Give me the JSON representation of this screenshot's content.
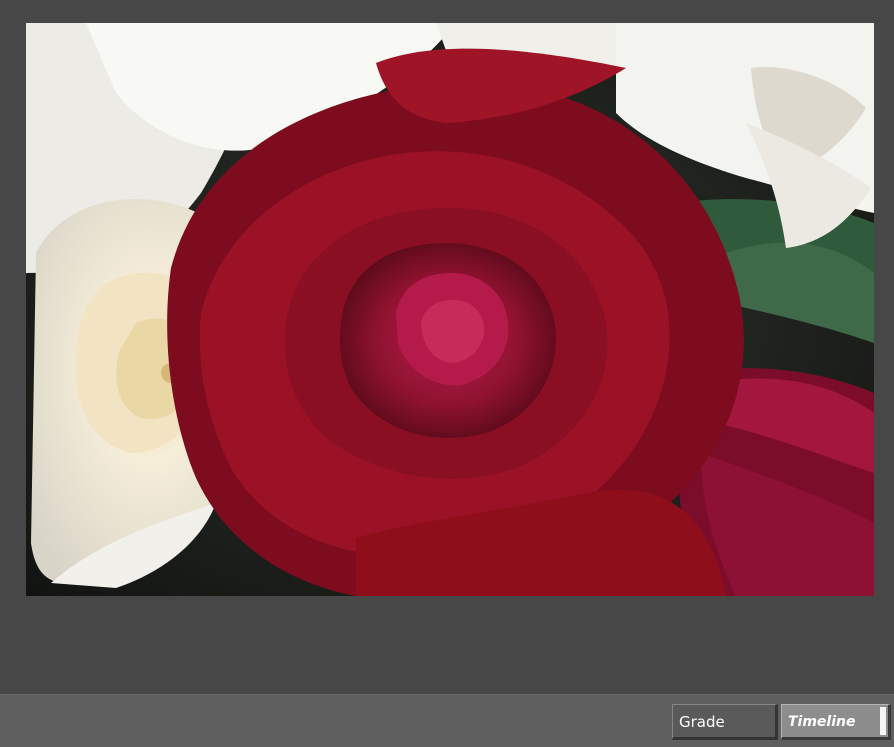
{
  "toolbar": {
    "grade_label": "Grade",
    "timeline_label": "Timeline"
  },
  "viewer": {
    "image_subject": "red-rose-with-white-roses-and-lilies"
  },
  "colors": {
    "background": "#474747",
    "bottom_bar": "#5f5f5f",
    "grade_button": "#5a5a5a",
    "timeline_button": "#8d8d8d"
  },
  "icons": {
    "timeline_indicator": "selected-indicator"
  }
}
